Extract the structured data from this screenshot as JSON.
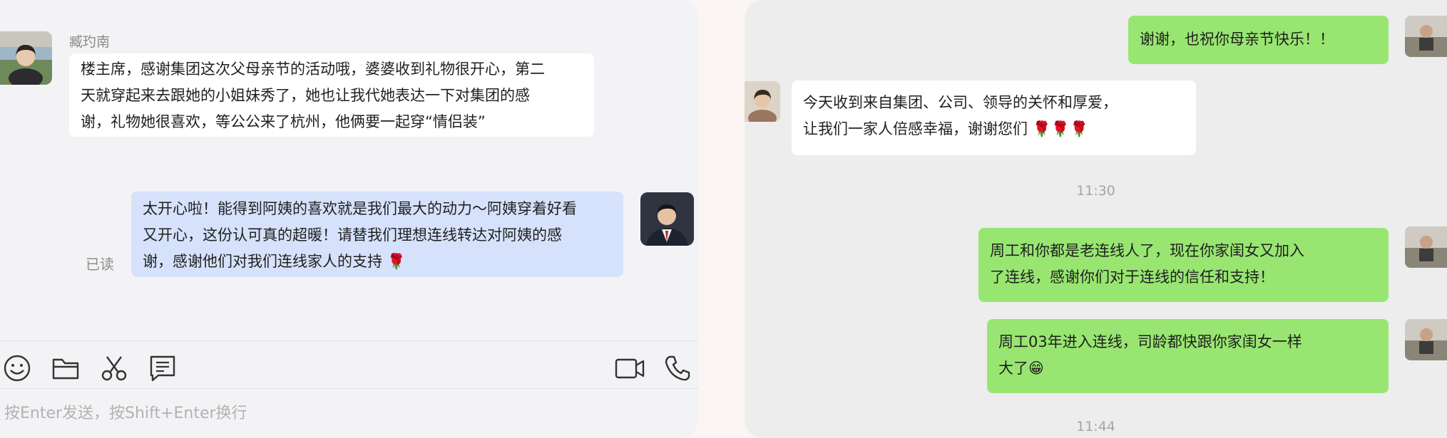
{
  "left_chat": {
    "messages": [
      {
        "sender": "臧玓南",
        "lines": [
          "楼主席，感谢集团这次父母亲节的活动哦，婆婆收到礼物很开心，第二",
          "天就穿起来去跟她的小姐妹秀了，她也让我代她表达一下对集团的感",
          "谢，礼物她很喜欢，等公公来了杭州，他俩要一起穿“情侣装”"
        ]
      },
      {
        "lines": [
          "太开心啦！能得到阿姨的喜欢就是我们最大的动力～阿姨穿着好看",
          "又开心，这份认可真的超暖！请替我们理想连线转达对阿姨的感",
          "谢，感谢他们对我们连线家人的支持"
        ],
        "emoji": "🌹",
        "read_status": "已读"
      }
    ],
    "toolbar": {
      "icons": [
        "emoji-icon",
        "folder-icon",
        "scissors-icon",
        "chat-history-icon",
        "video-call-icon",
        "phone-icon"
      ]
    },
    "input_placeholder": "按Enter发送，按Shift+Enter换行"
  },
  "right_chat": {
    "messages": [
      {
        "lines": [
          "谢谢，也祝你母亲节快乐！！"
        ]
      },
      {
        "lines": [
          "今天收到来自集团、公司、领导的关怀和厚爱，",
          "让我们一家人倍感幸福，谢谢您们"
        ],
        "emoji": "🌹🌹🌹"
      },
      {
        "lines": [
          "周工和你都是老连线人了，现在你家闺女又加入",
          "了连线，感谢你们对于连线的信任和支持！"
        ]
      },
      {
        "lines": [
          "周工03年进入连线，司龄都快跟你家闺女一样",
          "大了"
        ],
        "emoji": "😁"
      }
    ],
    "timestamps": [
      "11:30",
      "11:44"
    ]
  },
  "colors": {
    "left_bg": "#f3f3f6",
    "right_bg": "#ededed",
    "blue_bubble": "#d6e2fb",
    "green_bubble": "#98e671",
    "white_bubble": "#ffffff"
  }
}
